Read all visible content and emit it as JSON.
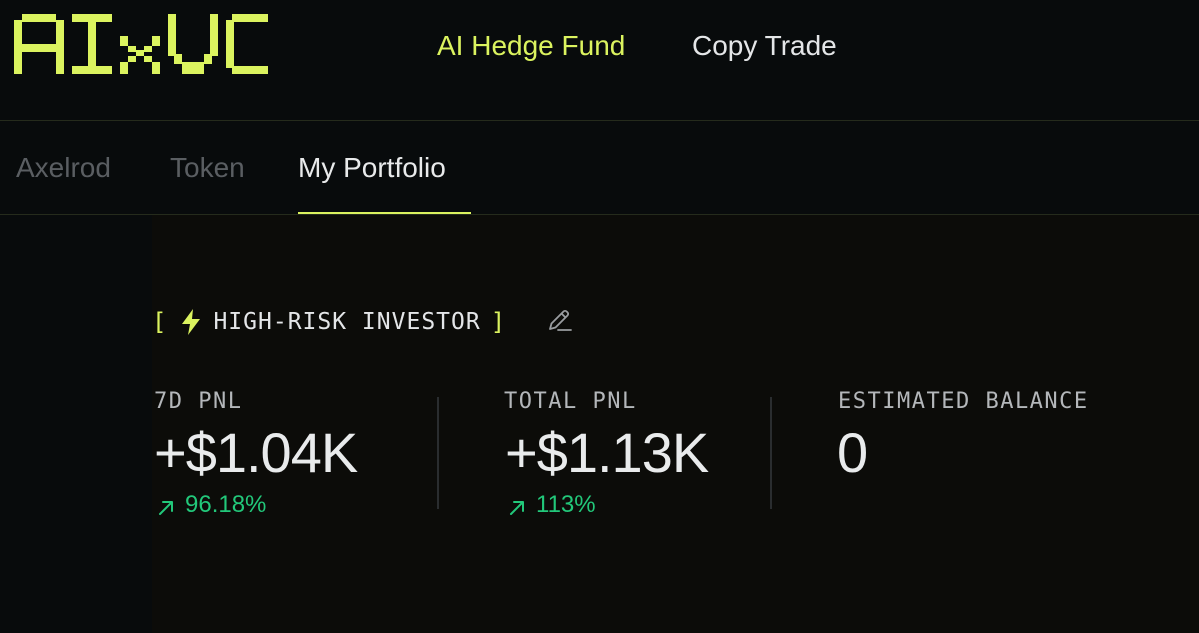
{
  "brand": {
    "logo_text": "AIxVC",
    "accent_color": "#dbf35f",
    "positive_color": "#22c87a"
  },
  "top_nav": {
    "items": [
      {
        "label": "AI Hedge Fund",
        "active": true
      },
      {
        "label": "Copy Trade",
        "active": false
      }
    ]
  },
  "tabs": {
    "items": [
      {
        "label": "Axelrod",
        "active": false
      },
      {
        "label": "Token",
        "active": false
      },
      {
        "label": "My Portfolio",
        "active": true
      }
    ]
  },
  "profile": {
    "open_bracket": "[",
    "risk_icon": "lightning-bolt-icon",
    "risk_label": "HIGH-RISK INVESTOR",
    "close_bracket": "]",
    "edit_icon": "pencil-icon"
  },
  "stats": [
    {
      "label": "7D PNL",
      "value": "+$1.04K",
      "change": "96.18%",
      "change_icon": "arrow-up-right-icon"
    },
    {
      "label": "TOTAL PNL",
      "value": "+$1.13K",
      "change": "113%",
      "change_icon": "arrow-up-right-icon"
    },
    {
      "label": "ESTIMATED BALANCE",
      "value": "0"
    }
  ]
}
